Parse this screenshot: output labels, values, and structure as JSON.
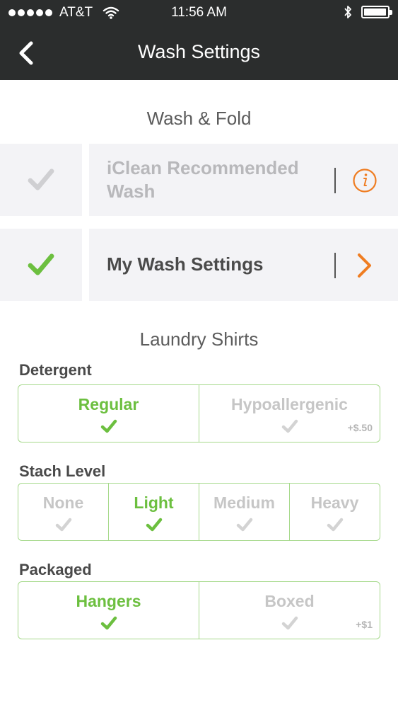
{
  "status_bar": {
    "carrier": "AT&T",
    "time": "11:56 AM",
    "signal_icon": "signal-dots-icon",
    "wifi_icon": "wifi-icon",
    "bluetooth_icon": "bluetooth-icon",
    "battery_icon": "battery-icon"
  },
  "nav": {
    "title": "Wash Settings",
    "back_icon": "chevron-left-icon"
  },
  "wash_fold": {
    "title": "Wash & Fold",
    "options": [
      {
        "label": "iClean Recommended Wash",
        "selected": false,
        "action_icon": "info-icon"
      },
      {
        "label": "My Wash Settings",
        "selected": true,
        "action_icon": "chevron-right-icon"
      }
    ]
  },
  "laundry_shirts": {
    "title": "Laundry Shirts",
    "groups": [
      {
        "label": "Detergent",
        "options": [
          {
            "label": "Regular",
            "selected": true,
            "price": ""
          },
          {
            "label": "Hypoallergenic",
            "selected": false,
            "price": "+$.50"
          }
        ]
      },
      {
        "label": "Stach Level",
        "options": [
          {
            "label": "None",
            "selected": false
          },
          {
            "label": "Light",
            "selected": true
          },
          {
            "label": "Medium",
            "selected": false
          },
          {
            "label": "Heavy",
            "selected": false
          }
        ]
      },
      {
        "label": "Packaged",
        "options": [
          {
            "label": "Hangers",
            "selected": true,
            "price": ""
          },
          {
            "label": "Boxed",
            "selected": false,
            "price": "+$1"
          }
        ]
      }
    ]
  },
  "colors": {
    "header_bg": "#2b2d2d",
    "accent_green": "#6cbf3f",
    "accent_orange": "#ef7d22",
    "inactive_gray": "#c6c6c6",
    "border_green": "#a6d98b",
    "option_bg": "#f3f3f6"
  }
}
